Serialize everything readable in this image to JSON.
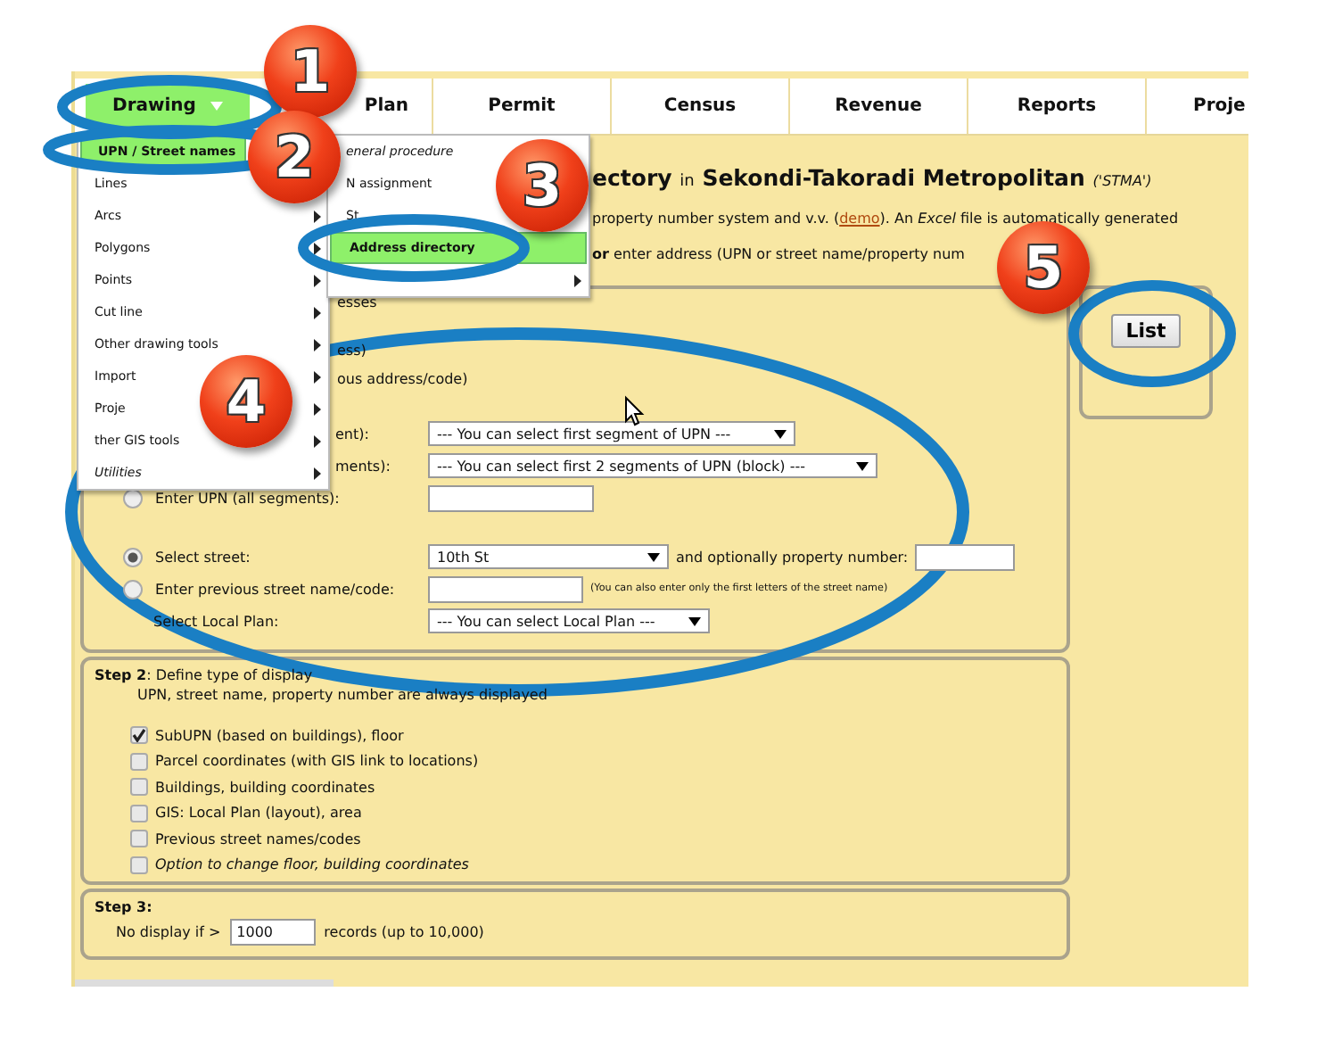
{
  "nav": {
    "tabs": [
      {
        "label": "Drawing",
        "selected": true
      },
      {
        "label": "Plan",
        "selected": false
      },
      {
        "label": "Permit",
        "selected": false
      },
      {
        "label": "Census",
        "selected": false
      },
      {
        "label": "Revenue",
        "selected": false
      },
      {
        "label": "Reports",
        "selected": false
      },
      {
        "label": "Proje",
        "selected": false
      }
    ]
  },
  "menu": {
    "items": [
      {
        "label": "UPN / Street names",
        "selected": true,
        "italic": false
      },
      {
        "label": "Lines",
        "selected": false,
        "italic": false
      },
      {
        "label": "Arcs",
        "selected": false,
        "submenu": true,
        "italic": false
      },
      {
        "label": "Polygons",
        "selected": false,
        "submenu": true,
        "italic": false
      },
      {
        "label": "Points",
        "selected": false,
        "submenu": true,
        "italic": false
      },
      {
        "label": "Cut line",
        "selected": false,
        "submenu": true,
        "italic": false
      },
      {
        "label": "Other drawing tools",
        "selected": false,
        "submenu": true,
        "italic": false
      },
      {
        "label": "Import",
        "selected": false,
        "submenu": true,
        "italic": false
      },
      {
        "label": "Proje",
        "selected": false,
        "submenu": true,
        "italic": false
      },
      {
        "label": "ther GIS tools",
        "selected": false,
        "submenu": true,
        "italic": false
      },
      {
        "label": "Utilities",
        "selected": false,
        "submenu": true,
        "italic": true
      }
    ]
  },
  "submenu": {
    "items": [
      {
        "label": "eneral procedure",
        "selected": false,
        "italic": true
      },
      {
        "label": "N assignment",
        "selected": false,
        "italic": false
      },
      {
        "label": "St",
        "selected": false,
        "italic": false
      },
      {
        "label": "Address directory",
        "selected": true,
        "italic": false
      },
      {
        "selected": false,
        "submenu": true
      }
    ]
  },
  "header": {
    "title": "ectory",
    "title_in": "in",
    "place": "Sekondi-Takoradi Metropolitan",
    "code": "('STMA')",
    "intro_before": "property number system and v.v. (",
    "intro_link": "demo",
    "intro_after": "). An *Excel* file is automatically generated",
    "instruction": "**or** enter address (UPN or street name/property num"
  },
  "step1": {
    "notes": [
      "esses",
      "ess)",
      "ous address/code)"
    ],
    "rows": [
      {
        "kind": "partial-select",
        "label": "ent):",
        "value": "--- You can select first segment of UPN ---"
      },
      {
        "kind": "partial-select",
        "label": "ments):",
        "value": "--- You can select first 2 segments of UPN (block) ---"
      },
      {
        "kind": "radio-input",
        "label": "Enter UPN (all segments):",
        "selected": false
      },
      {
        "kind": "radio-select",
        "label": "Select street:",
        "selected": true,
        "value": "10th St",
        "suffix": "and optionally property number:"
      },
      {
        "kind": "radio-input",
        "label": "Enter previous street name/code:",
        "selected": false,
        "hint": "(You can also enter only the first letters of the street name)"
      },
      {
        "kind": "select",
        "label": "Select Local Plan:",
        "value": "--- You can select Local Plan ---"
      }
    ]
  },
  "list_button": "List",
  "step2": {
    "heading": "**Step 2**: Define type of display",
    "note": "UPN, street name, property number are always displayed",
    "options": [
      {
        "label": "SubUPN (based on buildings), floor",
        "checked": true,
        "italic": false
      },
      {
        "label": "Parcel coordinates (with GIS link to locations)",
        "checked": false,
        "italic": false
      },
      {
        "label": "Buildings, building coordinates",
        "checked": false,
        "italic": false
      },
      {
        "label": "GIS: Local Plan (layout), area",
        "checked": false,
        "italic": false
      },
      {
        "label": "Previous street names/codes",
        "checked": false,
        "italic": false
      },
      {
        "label": "Option to change floor, building coordinates",
        "checked": false,
        "italic": true
      }
    ]
  },
  "step3": {
    "heading": "Step 3:",
    "prefix": "No display if >",
    "value": "1000",
    "suffix": "records (up to 10,000)"
  },
  "callouts": [
    {
      "number": "1"
    },
    {
      "number": "2"
    },
    {
      "number": "3"
    },
    {
      "number": "4"
    },
    {
      "number": "5"
    }
  ]
}
